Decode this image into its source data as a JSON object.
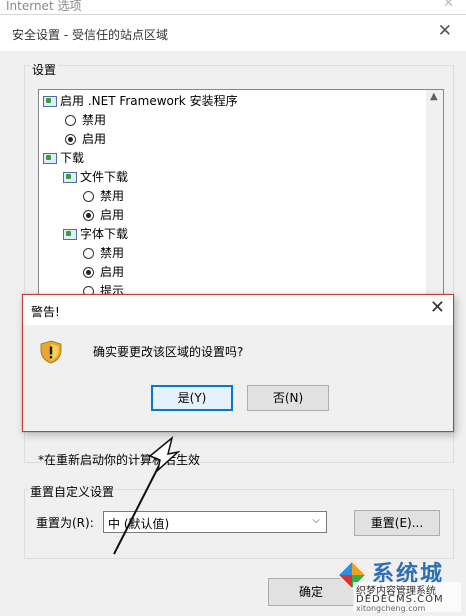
{
  "parent_window": {
    "title": "Internet 选项",
    "close_label": "✕"
  },
  "security_window": {
    "title": "安全设置 - 受信任的站点区域",
    "close_label": "✕",
    "settings_group_label": "设置",
    "settings_items": [
      {
        "type": "folder",
        "label": "启用 .NET Framework 安装程序",
        "icon": "setting-folder-icon"
      },
      {
        "type": "radio",
        "label": "禁用",
        "checked": false
      },
      {
        "type": "radio",
        "label": "启用",
        "checked": true
      },
      {
        "type": "folder",
        "label": "下载",
        "icon": "setting-folder-icon"
      },
      {
        "type": "folder",
        "label": "文件下载",
        "icon": "setting-folder-icon"
      },
      {
        "type": "radio",
        "label": "禁用",
        "checked": false
      },
      {
        "type": "radio",
        "label": "启用",
        "checked": true
      },
      {
        "type": "folder",
        "label": "字体下载",
        "icon": "setting-folder-icon"
      },
      {
        "type": "radio",
        "label": "禁用",
        "checked": false
      },
      {
        "type": "radio",
        "label": "启用",
        "checked": true
      },
      {
        "type": "radio",
        "label": "提示",
        "checked": false
      }
    ],
    "restart_note": "*在重新启动你的计算机后生效",
    "reset_group_label": "重置自定义设置",
    "reset_to_label": "重置为(R):",
    "reset_select_value": "中 (默认值)",
    "reset_button": "重置(E)...",
    "ok_button": "确定"
  },
  "warning_dialog": {
    "title": "警告!",
    "close_label": "✕",
    "message": "确实要更改该区域的设置吗?",
    "yes_button": "是(Y)",
    "no_button": "否(N)",
    "icon": "warning-shield-icon"
  },
  "watermark": {
    "brand": "系统城",
    "line1": "织梦内容管理系统",
    "line2": "DEDECMS.COM",
    "line3": "xitongcheng.com"
  },
  "colors": {
    "accent": "#0078d7",
    "dialog_border": "#c73a3a"
  }
}
